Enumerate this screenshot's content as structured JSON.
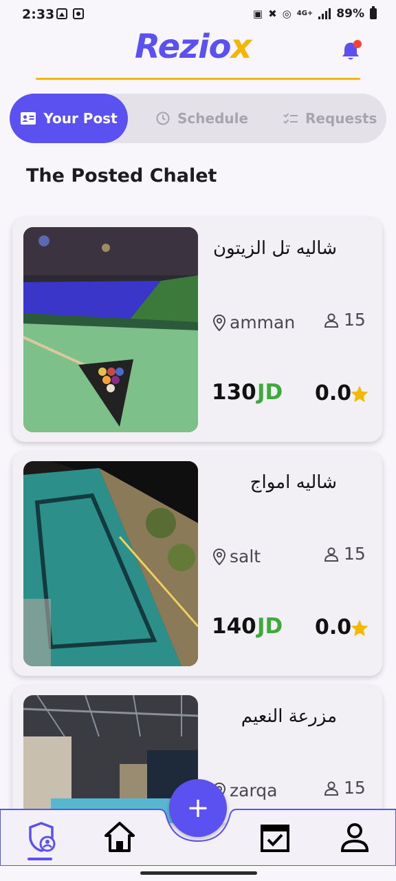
{
  "status_bar": {
    "time": "2:33",
    "network": "4G+",
    "battery": "89%"
  },
  "header": {
    "logo_main": "Rezio",
    "logo_accent": "x"
  },
  "tabs": [
    {
      "label": "Your Post",
      "active": true
    },
    {
      "label": "Schedule",
      "active": false
    },
    {
      "label": "Requests",
      "active": false
    }
  ],
  "section_title": "The Posted Chalet",
  "chalets": [
    {
      "title": "شاليه تل الزيتون",
      "location": "amman",
      "guests": "15",
      "price": "130",
      "currency": "JD",
      "rating": "0.0"
    },
    {
      "title": "شاليه امواج",
      "location": "salt",
      "guests": "15",
      "price": "140",
      "currency": "JD",
      "rating": "0.0"
    },
    {
      "title": "مزرعة النعيم",
      "location": "zarqa",
      "guests": "15",
      "price": "",
      "currency": "",
      "rating": ""
    }
  ],
  "fab": {
    "label": "+"
  },
  "bottom_nav": [
    "shield-user-icon",
    "home-icon",
    "calendar-check-icon",
    "profile-icon"
  ],
  "colors": {
    "primary": "#5b50f0",
    "accent": "#f2b705",
    "price_currency": "#3daa3a",
    "star": "#f5b800",
    "notification_dot": "#f44336"
  }
}
